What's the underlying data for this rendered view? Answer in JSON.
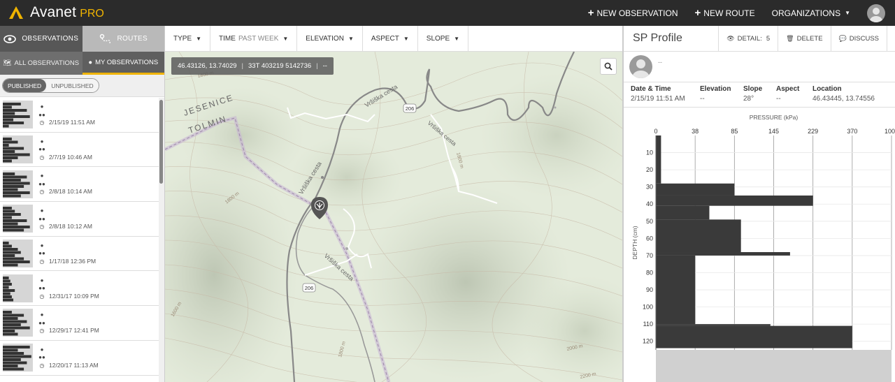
{
  "app": {
    "name": "Avanet",
    "edition": "PRO"
  },
  "topbar": {
    "new_observation": "NEW OBSERVATION",
    "new_route": "NEW ROUTE",
    "organizations": "ORGANIZATIONS"
  },
  "sidebar": {
    "tabs": [
      "OBSERVATIONS",
      "ROUTES"
    ],
    "subtabs": [
      "ALL OBSERVATIONS",
      "MY OBSERVATIONS"
    ],
    "publish_toggle": [
      "PUBLISHED",
      "UNPUBLISHED"
    ],
    "observations": [
      {
        "datetime": "2/15/19 11:51 AM"
      },
      {
        "datetime": "2/7/19 10:46 AM"
      },
      {
        "datetime": "2/8/18 10:14 AM"
      },
      {
        "datetime": "2/8/18 10:12 AM"
      },
      {
        "datetime": "1/17/18 12:36 PM"
      },
      {
        "datetime": "12/31/17 10:09 PM"
      },
      {
        "datetime": "12/29/17 12:41 PM"
      },
      {
        "datetime": "12/20/17 11:13 AM"
      }
    ]
  },
  "filters": [
    {
      "label": "TYPE",
      "value": ""
    },
    {
      "label": "TIME",
      "value": "PAST WEEK"
    },
    {
      "label": "ELEVATION",
      "value": ""
    },
    {
      "label": "ASPECT",
      "value": ""
    },
    {
      "label": "SLOPE",
      "value": ""
    }
  ],
  "map": {
    "latlon": "46.43126, 13.74029",
    "utm": "33T 403219 5142736",
    "extra": "--",
    "labels": {
      "region1": "JESENICE",
      "region2": "TOLMIN",
      "road1": "Vršiška cesta",
      "road2": "Vršiška cesta",
      "road3": "Vršiška cesta",
      "road4": "Vršiška cesta",
      "route_badge1": "206",
      "route_badge2": "206",
      "contour1": "1800 m",
      "contour2": "1800 m",
      "contour3": "1800 m",
      "contour4": "2000 m",
      "contour5": "2200 m",
      "contour6": "1800 m",
      "contour7": "1600 m"
    }
  },
  "panel": {
    "title": "SP Profile",
    "detail_label": "DETAIL:",
    "detail_value": "5",
    "delete": "DELETE",
    "discuss": "DISCUSS",
    "author": "--",
    "info": {
      "date_label": "Date & Time",
      "date_value": "2/15/19 11:51 AM",
      "elevation_label": "Elevation",
      "elevation_value": "--",
      "slope_label": "Slope",
      "slope_value": "28°",
      "aspect_label": "Aspect",
      "aspect_value": "--",
      "location_label": "Location",
      "location_value": "46.43445, 13.74556"
    }
  },
  "colors": {
    "accent": "#f0b400",
    "topbar": "#2b2b2b",
    "map_bg": "#e4ebdb",
    "profile_bar": "#3a3a3a"
  },
  "chart_data": {
    "type": "bar",
    "orientation": "horizontal-step",
    "title": "PRESSURE (kPa)",
    "xlabel": "PRESSURE (kPa)",
    "ylabel": "DEPTH (cm)",
    "x_ticks": [
      0,
      38,
      85,
      145,
      229,
      370,
      1000
    ],
    "y_ticks": [
      10,
      20,
      30,
      40,
      50,
      60,
      70,
      80,
      90,
      100,
      110,
      120
    ],
    "ylim": [
      0,
      125
    ],
    "segments": [
      {
        "depth_from": 0,
        "depth_to": 28,
        "pressure": 5
      },
      {
        "depth_from": 28,
        "depth_to": 35,
        "pressure": 85
      },
      {
        "depth_from": 35,
        "depth_to": 41,
        "pressure": 229
      },
      {
        "depth_from": 41,
        "depth_to": 49,
        "pressure": 55
      },
      {
        "depth_from": 49,
        "depth_to": 68,
        "pressure": 95
      },
      {
        "depth_from": 68,
        "depth_to": 70,
        "pressure": 180
      },
      {
        "depth_from": 70,
        "depth_to": 110,
        "pressure": 38
      },
      {
        "depth_from": 110,
        "depth_to": 111,
        "pressure": 140
      },
      {
        "depth_from": 111,
        "depth_to": 124,
        "pressure": 370
      }
    ]
  }
}
